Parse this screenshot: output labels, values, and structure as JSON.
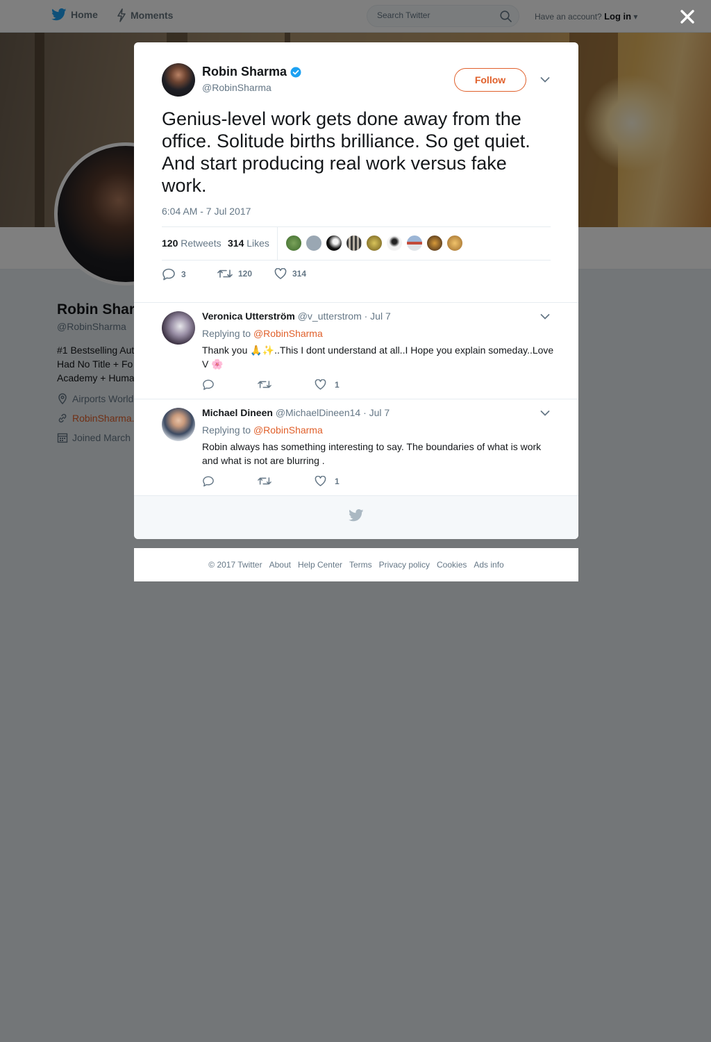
{
  "topbar": {
    "home_label": "Home",
    "moments_label": "Moments",
    "search_placeholder": "Search Twitter",
    "account_prompt": "Have an account?",
    "login_label": "Log in"
  },
  "profile": {
    "name": "Robin Shar",
    "handle": "@RobinSharma",
    "bio_lines": [
      "#1 Bestselling Aut",
      "Had No Title + Fo",
      "Academy + Huma"
    ],
    "location": "Airports World",
    "website": "RobinSharma.",
    "joined": "Joined March"
  },
  "tweet": {
    "author_name": "Robin Sharma",
    "author_handle": "@RobinSharma",
    "verified": true,
    "follow_label": "Follow",
    "text": "Genius-level work gets done away from the office. Solitude births brilliance. So get quiet. And start producing real work versus fake work.",
    "timestamp": "6:04 AM - 7 Jul 2017",
    "retweets_count": "120",
    "retweets_label": "Retweets",
    "likes_count": "314",
    "likes_label": "Likes",
    "reply_count": "3",
    "retweet_action_count": "120",
    "like_action_count": "314"
  },
  "replies": [
    {
      "name": "Veronica Utterström",
      "handle": "@v_utterstrom",
      "date": "· Jul 7",
      "replying_prefix": "Replying to",
      "replying_to": "@RobinSharma",
      "text": "Thank you 🙏✨..This I dont understand at all..I Hope you explain someday..Love V 🌸",
      "likes": "1"
    },
    {
      "name": "Michael Dineen",
      "handle": "@MichaelDineen14",
      "date": "· Jul 7",
      "replying_prefix": "Replying to",
      "replying_to": "@RobinSharma",
      "text": "Robin always has something interesting to say. The boundaries of what is work and what is not are blurring .",
      "likes": "1"
    }
  ],
  "footer": {
    "copyright": "© 2017 Twitter",
    "links": [
      "About",
      "Help Center",
      "Terms",
      "Privacy policy",
      "Cookies",
      "Ads info"
    ]
  },
  "colors": {
    "accent": "#e0602b",
    "twitter_blue": "#1da1f2",
    "muted": "#657786"
  }
}
